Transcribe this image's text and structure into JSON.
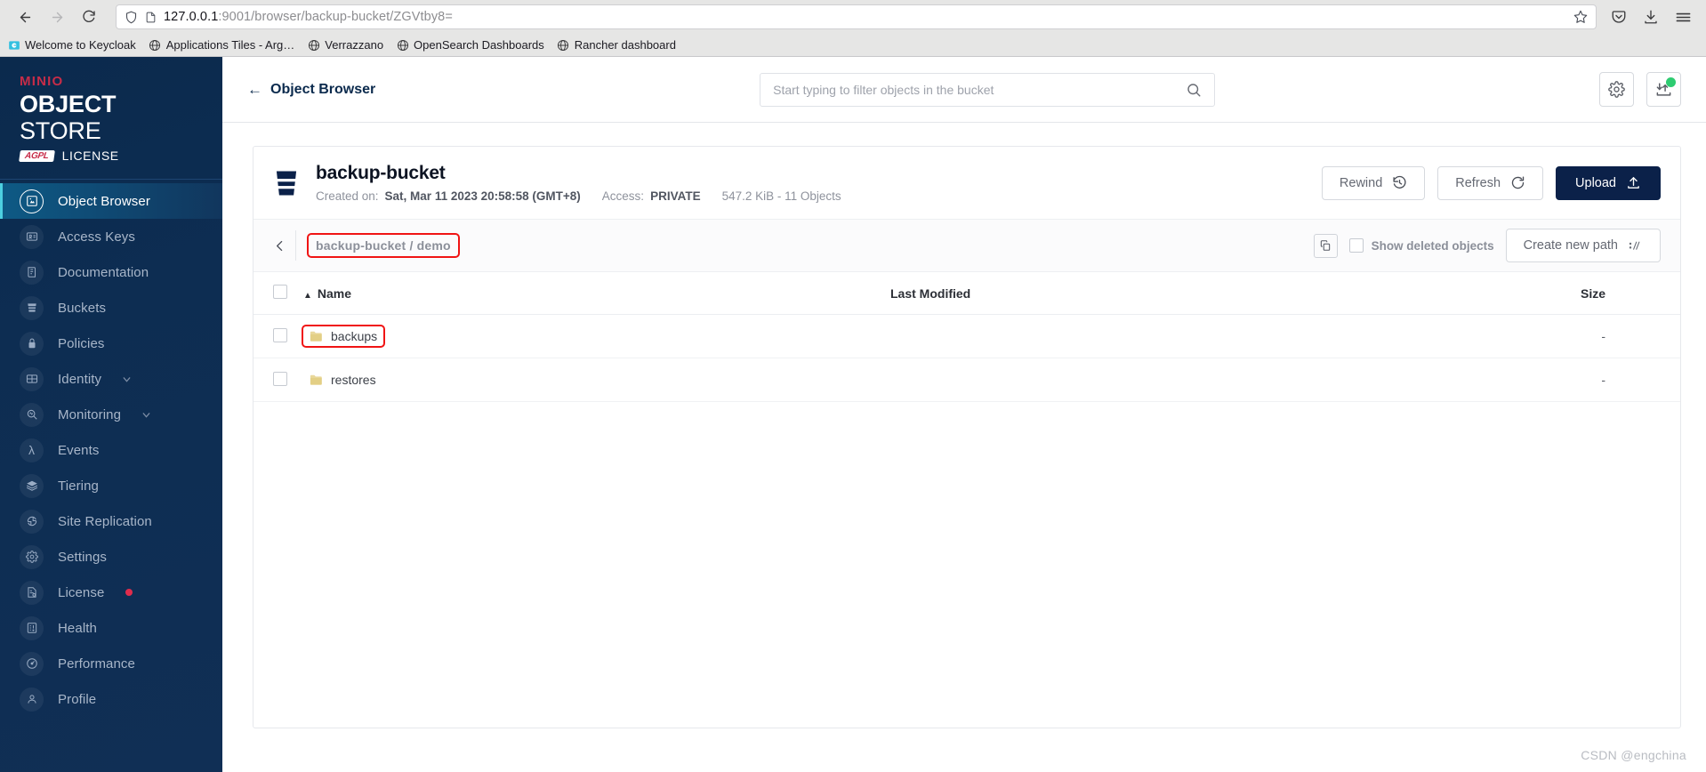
{
  "browser": {
    "back_icon": "back-arrow-icon",
    "forward_icon": "forward-arrow-icon",
    "reload_icon": "reload-icon",
    "url_host": "127.0.0.1",
    "url_rest": ":9001/browser/backup-bucket/ZGVtby8=",
    "url_full": "127.0.0.1:9001/browser/backup-bucket/ZGVtby8=",
    "shield_icon": "shield-icon",
    "page-icon": "page-icon",
    "bookmark_star_icon": "star-icon",
    "pocket_icon": "pocket-save-icon",
    "downloads_icon": "downloads-icon",
    "menu_icon": "hamburger-menu-icon",
    "bookmarks": [
      {
        "label": "Welcome to Keycloak",
        "favicon": "keycloak-favicon"
      },
      {
        "label": "Applications Tiles - Arg…",
        "favicon": "globe-favicon"
      },
      {
        "label": "Verrazzano",
        "favicon": "globe-favicon"
      },
      {
        "label": "OpenSearch Dashboards",
        "favicon": "globe-favicon"
      },
      {
        "label": "Rancher dashboard",
        "favicon": "globe-favicon"
      }
    ]
  },
  "sidebar": {
    "logo": {
      "brand": "MINIO",
      "product_bold": "OBJECT",
      "product_light": "STORE",
      "license_badge": "AGPL",
      "license_word": "LICENSE"
    },
    "items": [
      {
        "label": "Object Browser",
        "icon": "object-browser-icon",
        "active": true
      },
      {
        "label": "Access Keys",
        "icon": "access-keys-icon"
      },
      {
        "label": "Documentation",
        "icon": "documentation-icon"
      },
      {
        "label": "Buckets",
        "icon": "bucket-icon"
      },
      {
        "label": "Policies",
        "icon": "policies-lock-icon"
      },
      {
        "label": "Identity",
        "icon": "identity-icon",
        "expandable": true
      },
      {
        "label": "Monitoring",
        "icon": "monitoring-icon",
        "expandable": true
      },
      {
        "label": "Events",
        "icon": "events-lambda-icon"
      },
      {
        "label": "Tiering",
        "icon": "tiering-layers-icon"
      },
      {
        "label": "Site Replication",
        "icon": "site-replication-icon"
      },
      {
        "label": "Settings",
        "icon": "gear-icon"
      },
      {
        "label": "License",
        "icon": "license-icon",
        "alert": true
      },
      {
        "label": "Health",
        "icon": "health-icon"
      },
      {
        "label": "Performance",
        "icon": "performance-icon"
      },
      {
        "label": "Profile",
        "icon": "profile-icon"
      }
    ]
  },
  "topbar": {
    "back_label": "Object Browser",
    "back_arrow": "←",
    "search_placeholder": "Start typing to filter objects in the bucket",
    "search_value": "",
    "settings_icon": "gear-icon",
    "transfer_icon": "object-transfer-icon"
  },
  "bucket": {
    "name": "backup-bucket",
    "created_label": "Created on:",
    "created_value": "Sat, Mar 11 2023 20:58:58 (GMT+8)",
    "access_label": "Access:",
    "access_value": "PRIVATE",
    "size_objects": "547.2 KiB - 11 Objects",
    "actions": {
      "rewind": "Rewind",
      "refresh": "Refresh",
      "upload": "Upload"
    }
  },
  "breadcrumb": {
    "path": "backup-bucket / demo",
    "back_icon": "chevron-left-icon",
    "copy_icon": "copy-icon",
    "show_deleted_label": "Show deleted objects",
    "show_deleted_checked": false,
    "create_path_label": "Create new path"
  },
  "table": {
    "columns": [
      "Name",
      "Last Modified",
      "Size"
    ],
    "sort_column": "Name",
    "sort_direction": "asc",
    "rows": [
      {
        "name": "backups",
        "last_modified": "",
        "size": "-",
        "type": "folder",
        "highlighted": true
      },
      {
        "name": "restores",
        "last_modified": "",
        "size": "-",
        "type": "folder",
        "highlighted": false
      }
    ]
  },
  "watermark": "CSDN @engchina",
  "colors": {
    "sidebar_bg": "#0d2d52",
    "accent_red": "#c72c48",
    "primary_navy": "#0b2149",
    "annotation_red": "#f01414",
    "badge_green": "#2ecc71",
    "alert_red": "#e02c4c"
  }
}
